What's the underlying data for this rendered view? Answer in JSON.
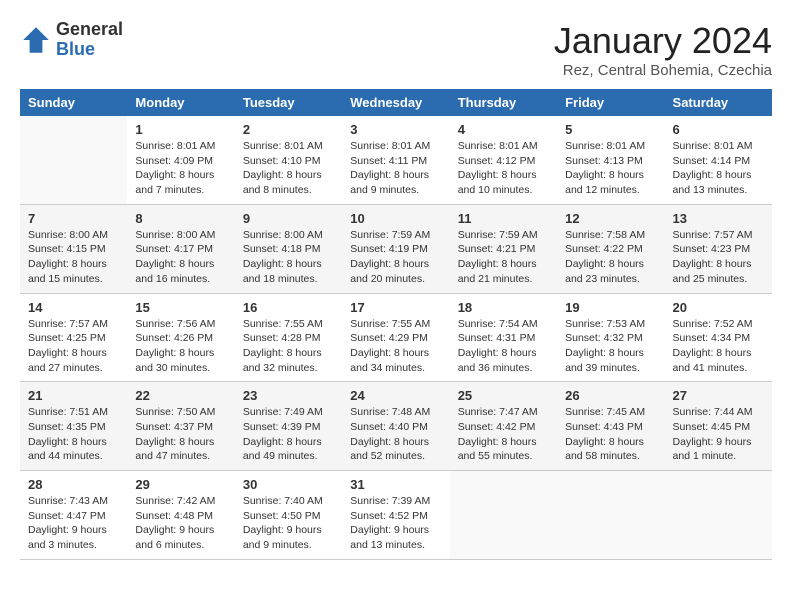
{
  "logo": {
    "general": "General",
    "blue": "Blue"
  },
  "header": {
    "month": "January 2024",
    "subtitle": "Rez, Central Bohemia, Czechia"
  },
  "weekdays": [
    "Sunday",
    "Monday",
    "Tuesday",
    "Wednesday",
    "Thursday",
    "Friday",
    "Saturday"
  ],
  "weeks": [
    [
      {
        "day": "",
        "sunrise": "",
        "sunset": "",
        "daylight": ""
      },
      {
        "day": "1",
        "sunrise": "Sunrise: 8:01 AM",
        "sunset": "Sunset: 4:09 PM",
        "daylight": "Daylight: 8 hours and 7 minutes."
      },
      {
        "day": "2",
        "sunrise": "Sunrise: 8:01 AM",
        "sunset": "Sunset: 4:10 PM",
        "daylight": "Daylight: 8 hours and 8 minutes."
      },
      {
        "day": "3",
        "sunrise": "Sunrise: 8:01 AM",
        "sunset": "Sunset: 4:11 PM",
        "daylight": "Daylight: 8 hours and 9 minutes."
      },
      {
        "day": "4",
        "sunrise": "Sunrise: 8:01 AM",
        "sunset": "Sunset: 4:12 PM",
        "daylight": "Daylight: 8 hours and 10 minutes."
      },
      {
        "day": "5",
        "sunrise": "Sunrise: 8:01 AM",
        "sunset": "Sunset: 4:13 PM",
        "daylight": "Daylight: 8 hours and 12 minutes."
      },
      {
        "day": "6",
        "sunrise": "Sunrise: 8:01 AM",
        "sunset": "Sunset: 4:14 PM",
        "daylight": "Daylight: 8 hours and 13 minutes."
      }
    ],
    [
      {
        "day": "7",
        "sunrise": "Sunrise: 8:00 AM",
        "sunset": "Sunset: 4:15 PM",
        "daylight": "Daylight: 8 hours and 15 minutes."
      },
      {
        "day": "8",
        "sunrise": "Sunrise: 8:00 AM",
        "sunset": "Sunset: 4:17 PM",
        "daylight": "Daylight: 8 hours and 16 minutes."
      },
      {
        "day": "9",
        "sunrise": "Sunrise: 8:00 AM",
        "sunset": "Sunset: 4:18 PM",
        "daylight": "Daylight: 8 hours and 18 minutes."
      },
      {
        "day": "10",
        "sunrise": "Sunrise: 7:59 AM",
        "sunset": "Sunset: 4:19 PM",
        "daylight": "Daylight: 8 hours and 20 minutes."
      },
      {
        "day": "11",
        "sunrise": "Sunrise: 7:59 AM",
        "sunset": "Sunset: 4:21 PM",
        "daylight": "Daylight: 8 hours and 21 minutes."
      },
      {
        "day": "12",
        "sunrise": "Sunrise: 7:58 AM",
        "sunset": "Sunset: 4:22 PM",
        "daylight": "Daylight: 8 hours and 23 minutes."
      },
      {
        "day": "13",
        "sunrise": "Sunrise: 7:57 AM",
        "sunset": "Sunset: 4:23 PM",
        "daylight": "Daylight: 8 hours and 25 minutes."
      }
    ],
    [
      {
        "day": "14",
        "sunrise": "Sunrise: 7:57 AM",
        "sunset": "Sunset: 4:25 PM",
        "daylight": "Daylight: 8 hours and 27 minutes."
      },
      {
        "day": "15",
        "sunrise": "Sunrise: 7:56 AM",
        "sunset": "Sunset: 4:26 PM",
        "daylight": "Daylight: 8 hours and 30 minutes."
      },
      {
        "day": "16",
        "sunrise": "Sunrise: 7:55 AM",
        "sunset": "Sunset: 4:28 PM",
        "daylight": "Daylight: 8 hours and 32 minutes."
      },
      {
        "day": "17",
        "sunrise": "Sunrise: 7:55 AM",
        "sunset": "Sunset: 4:29 PM",
        "daylight": "Daylight: 8 hours and 34 minutes."
      },
      {
        "day": "18",
        "sunrise": "Sunrise: 7:54 AM",
        "sunset": "Sunset: 4:31 PM",
        "daylight": "Daylight: 8 hours and 36 minutes."
      },
      {
        "day": "19",
        "sunrise": "Sunrise: 7:53 AM",
        "sunset": "Sunset: 4:32 PM",
        "daylight": "Daylight: 8 hours and 39 minutes."
      },
      {
        "day": "20",
        "sunrise": "Sunrise: 7:52 AM",
        "sunset": "Sunset: 4:34 PM",
        "daylight": "Daylight: 8 hours and 41 minutes."
      }
    ],
    [
      {
        "day": "21",
        "sunrise": "Sunrise: 7:51 AM",
        "sunset": "Sunset: 4:35 PM",
        "daylight": "Daylight: 8 hours and 44 minutes."
      },
      {
        "day": "22",
        "sunrise": "Sunrise: 7:50 AM",
        "sunset": "Sunset: 4:37 PM",
        "daylight": "Daylight: 8 hours and 47 minutes."
      },
      {
        "day": "23",
        "sunrise": "Sunrise: 7:49 AM",
        "sunset": "Sunset: 4:39 PM",
        "daylight": "Daylight: 8 hours and 49 minutes."
      },
      {
        "day": "24",
        "sunrise": "Sunrise: 7:48 AM",
        "sunset": "Sunset: 4:40 PM",
        "daylight": "Daylight: 8 hours and 52 minutes."
      },
      {
        "day": "25",
        "sunrise": "Sunrise: 7:47 AM",
        "sunset": "Sunset: 4:42 PM",
        "daylight": "Daylight: 8 hours and 55 minutes."
      },
      {
        "day": "26",
        "sunrise": "Sunrise: 7:45 AM",
        "sunset": "Sunset: 4:43 PM",
        "daylight": "Daylight: 8 hours and 58 minutes."
      },
      {
        "day": "27",
        "sunrise": "Sunrise: 7:44 AM",
        "sunset": "Sunset: 4:45 PM",
        "daylight": "Daylight: 9 hours and 1 minute."
      }
    ],
    [
      {
        "day": "28",
        "sunrise": "Sunrise: 7:43 AM",
        "sunset": "Sunset: 4:47 PM",
        "daylight": "Daylight: 9 hours and 3 minutes."
      },
      {
        "day": "29",
        "sunrise": "Sunrise: 7:42 AM",
        "sunset": "Sunset: 4:48 PM",
        "daylight": "Daylight: 9 hours and 6 minutes."
      },
      {
        "day": "30",
        "sunrise": "Sunrise: 7:40 AM",
        "sunset": "Sunset: 4:50 PM",
        "daylight": "Daylight: 9 hours and 9 minutes."
      },
      {
        "day": "31",
        "sunrise": "Sunrise: 7:39 AM",
        "sunset": "Sunset: 4:52 PM",
        "daylight": "Daylight: 9 hours and 13 minutes."
      },
      {
        "day": "",
        "sunrise": "",
        "sunset": "",
        "daylight": ""
      },
      {
        "day": "",
        "sunrise": "",
        "sunset": "",
        "daylight": ""
      },
      {
        "day": "",
        "sunrise": "",
        "sunset": "",
        "daylight": ""
      }
    ]
  ]
}
